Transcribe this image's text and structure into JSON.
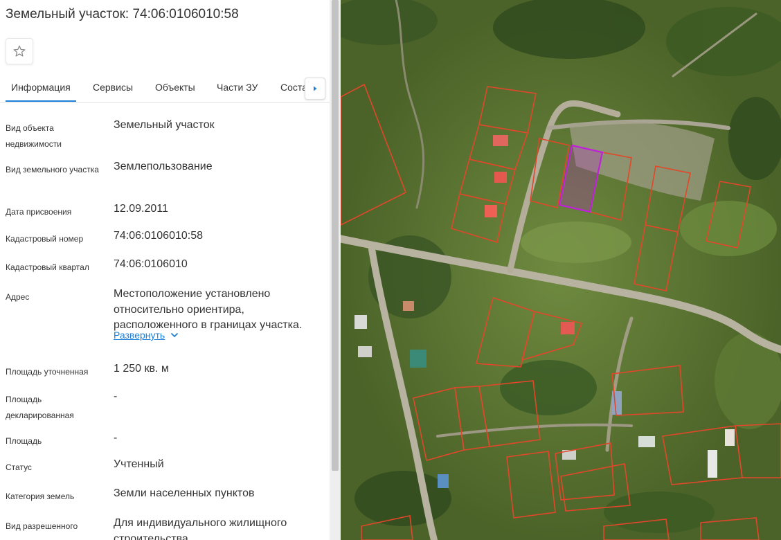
{
  "header": {
    "title": "Земельный участок: 74:06:0106010:58"
  },
  "icons": {
    "favorite": "star-outline-icon",
    "tabs_next": "caret-right-icon",
    "expand": "chevron-down-icon"
  },
  "tabs": [
    {
      "label": "Информация",
      "active": true
    },
    {
      "label": "Сервисы",
      "active": false
    },
    {
      "label": "Объекты",
      "active": false
    },
    {
      "label": "Части ЗУ",
      "active": false
    },
    {
      "label": "Состав",
      "active": false
    }
  ],
  "info": {
    "object_type": {
      "label": "Вид объекта недвижимости",
      "value": "Земельный участок"
    },
    "parcel_type": {
      "label": "Вид земельного участка",
      "value": "Землепользование"
    },
    "assign_date": {
      "label": "Дата присвоения",
      "value": "12.09.2011"
    },
    "cadastral_number": {
      "label": "Кадастровый номер",
      "value": "74:06:0106010:58"
    },
    "cadastral_quarter": {
      "label": "Кадастровый квартал",
      "value": "74:06:0106010"
    },
    "address": {
      "label": "Адрес",
      "value": "Местоположение установлено относительно ориентира, расположенного в границах участка.",
      "expand_label": "Развернуть"
    },
    "area_specified": {
      "label": "Площадь уточненная",
      "value": "1 250 кв. м"
    },
    "area_declared": {
      "label": "Площадь декларированная",
      "value": "-"
    },
    "area": {
      "label": "Площадь",
      "value": "-"
    },
    "status": {
      "label": "Статус",
      "value": "Учтенный"
    },
    "land_category": {
      "label": "Категория земель",
      "value": "Земли населенных пунктов"
    },
    "permitted_use": {
      "label": "Вид разрешенного использования",
      "value": "Для индивидуального жилищного строительства"
    }
  },
  "colors": {
    "accent": "#1e7fd6",
    "parcel_border": "#e2472a",
    "selected_parcel": "#c020d8"
  }
}
